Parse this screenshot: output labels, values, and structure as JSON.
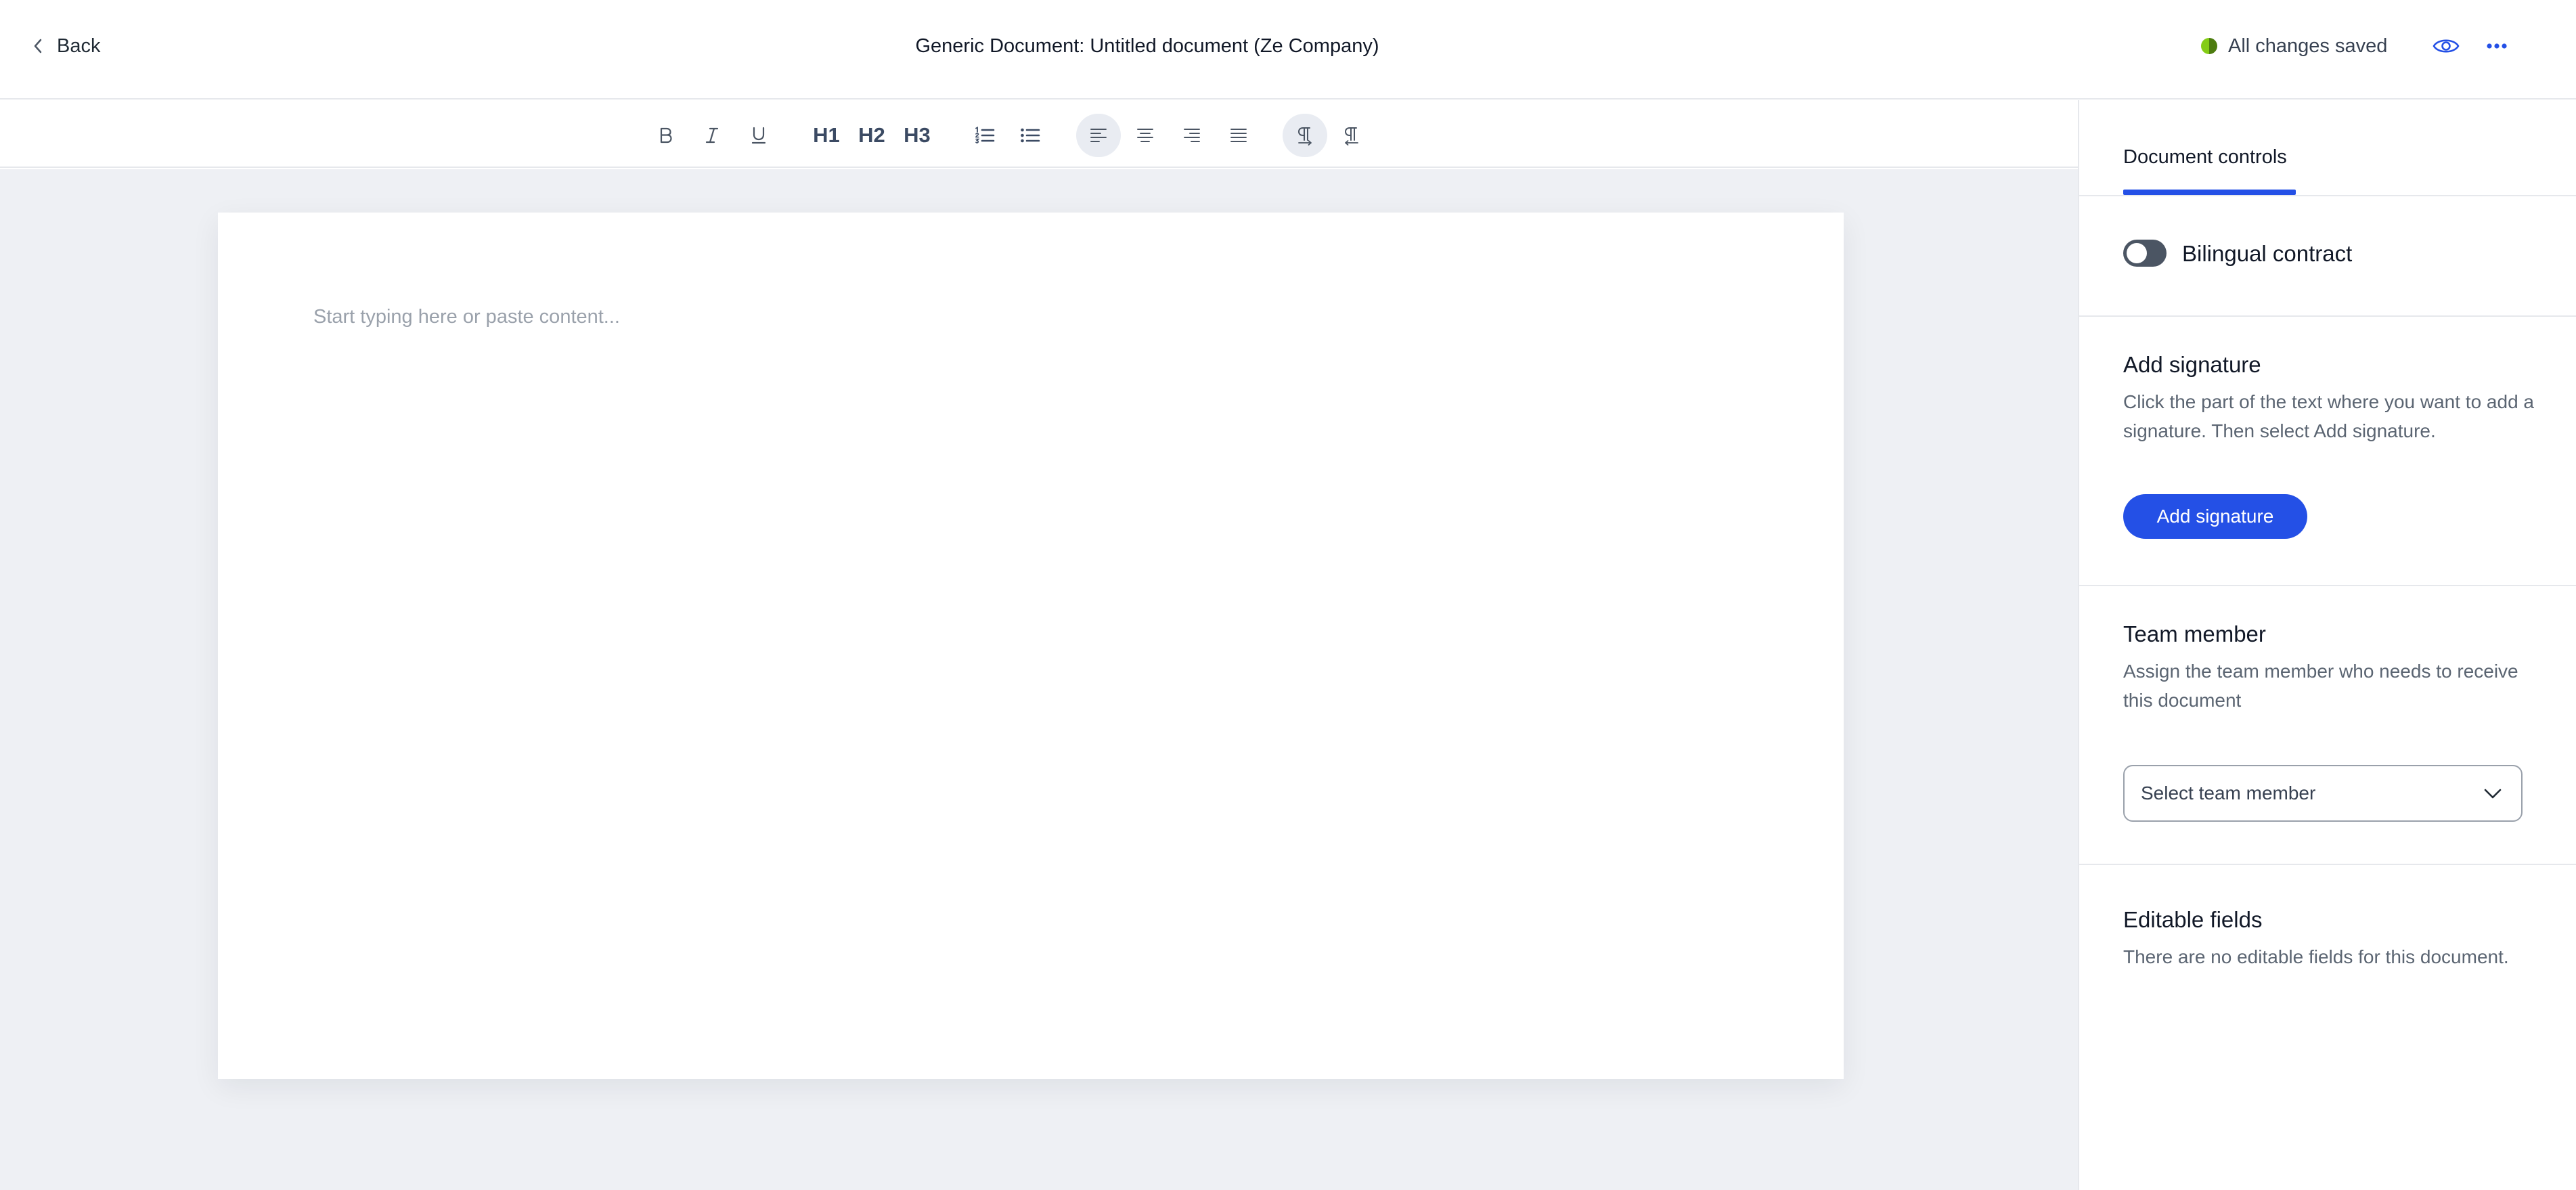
{
  "header": {
    "back_label": "Back",
    "title": "Generic Document: Untitled document (Ze Company)",
    "save_status": "All changes saved",
    "status_color": "#84cc16",
    "icons": [
      "chevron-left-icon",
      "eye-icon",
      "more-horizontal-icon"
    ]
  },
  "toolbar": {
    "h1": "H1",
    "h2": "H2",
    "h3": "H3",
    "buttons": [
      "bold",
      "italic",
      "underline",
      "h1",
      "h2",
      "h3",
      "ordered-list",
      "bullet-list",
      "align-left",
      "align-center",
      "align-right",
      "align-justify",
      "ltr",
      "rtl"
    ],
    "active": [
      "align-left",
      "ltr"
    ]
  },
  "editor": {
    "placeholder": "Start typing here or paste content..."
  },
  "panel": {
    "tab_label": "Document controls",
    "bilingual": {
      "label": "Bilingual contract",
      "enabled": false
    },
    "signature": {
      "title": "Add signature",
      "description": "Click the part of the text where you want to add a signature. Then select Add signature.",
      "button_label": "Add signature"
    },
    "team": {
      "title": "Team member",
      "description": "Assign the team member who needs to receive this document",
      "select_placeholder": "Select team member"
    },
    "editable": {
      "title": "Editable fields",
      "description": "There are no editable fields for this document."
    }
  },
  "colors": {
    "accent": "#2450e6",
    "canvas": "#eef0f4"
  }
}
